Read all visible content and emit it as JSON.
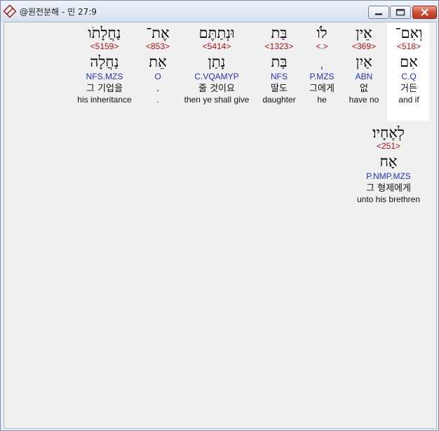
{
  "window": {
    "title": "@원전분해 - 민 27:9"
  },
  "words": [
    {
      "id": "w1",
      "heb": "וְאִם־",
      "strong": "<518>",
      "lemma": "אִם",
      "morph": "C.Q",
      "kor": "거든",
      "eng": "and if"
    },
    {
      "id": "w2",
      "heb": "אֵין",
      "strong": "<369>",
      "lemma": "אַיִן",
      "morph": "ABN",
      "kor": "없",
      "eng": "have no"
    },
    {
      "id": "w3",
      "heb": "לֹו",
      "strong": "<.>",
      "lemma": "ְ",
      "morph": "P.MZS",
      "kor": "그에게",
      "eng": "he"
    },
    {
      "id": "w4",
      "heb": "בַּת",
      "strong": "<1323>",
      "lemma": "בַּת",
      "morph": "NFS",
      "kor": "딸도",
      "eng": "daughter"
    },
    {
      "id": "w5",
      "heb": "וּנְתַתֶּם",
      "strong": "<5414>",
      "lemma": "נָתַן",
      "morph": "C.VQAMYP",
      "kor": "줄 것이요",
      "eng": "then ye shall give"
    },
    {
      "id": "w6",
      "heb": "אֶת־",
      "strong": "<853>",
      "lemma": "אֵת",
      "morph": "O",
      "kor": ".",
      "eng": "."
    },
    {
      "id": "w7",
      "heb": "נַחֲלָתֹו",
      "strong": "<5159>",
      "lemma": "נַחֲלָה",
      "morph": "NFS.MZS",
      "kor": "그 기업을",
      "eng": "his inheritance"
    },
    {
      "id": "w8",
      "heb": "לְאֶחָיו׃",
      "strong": "<251>",
      "lemma": "אָח",
      "morph": "P.NMP.MZS",
      "kor": "그 형제에게",
      "eng": "unto his brethren"
    }
  ]
}
